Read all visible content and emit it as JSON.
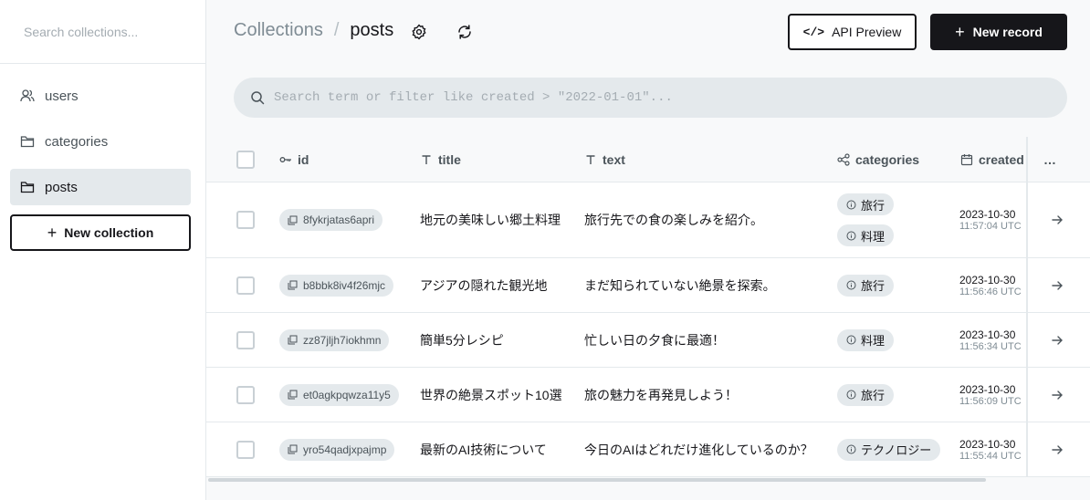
{
  "sidebar": {
    "search_placeholder": "Search collections...",
    "items": [
      {
        "label": "users",
        "icon": "users-icon",
        "active": false
      },
      {
        "label": "categories",
        "icon": "folder-icon",
        "active": false
      },
      {
        "label": "posts",
        "icon": "folder-icon",
        "active": true
      }
    ],
    "new_collection_label": "New collection"
  },
  "header": {
    "breadcrumb_parent": "Collections",
    "breadcrumb_separator": "/",
    "breadcrumb_current": "posts",
    "api_preview_label": "API Preview",
    "new_record_label": "New record"
  },
  "search": {
    "placeholder": "Search term or filter like created > \"2022-01-01\"..."
  },
  "table": {
    "columns": [
      {
        "label": "id",
        "icon": "key-icon"
      },
      {
        "label": "title",
        "icon": "text-type-icon"
      },
      {
        "label": "text",
        "icon": "text-type-icon"
      },
      {
        "label": "categories",
        "icon": "relation-icon"
      },
      {
        "label": "created",
        "icon": "calendar-icon"
      }
    ],
    "more_label": "…",
    "rows": [
      {
        "id": "8fykrjatas6apri",
        "title": "地元の美味しい郷土料理",
        "text": "旅行先での食の楽しみを紹介。",
        "categories": [
          "旅行",
          "料理"
        ],
        "date": "2023-10-30",
        "time": "11:57:04 UTC"
      },
      {
        "id": "b8bbk8iv4f26mjc",
        "title": "アジアの隠れた観光地",
        "text": "まだ知られていない絶景を探索。",
        "categories": [
          "旅行"
        ],
        "date": "2023-10-30",
        "time": "11:56:46 UTC"
      },
      {
        "id": "zz87jljh7iokhmn",
        "title": "簡単5分レシピ",
        "text": "忙しい日の夕食に最適！",
        "categories": [
          "料理"
        ],
        "date": "2023-10-30",
        "time": "11:56:34 UTC"
      },
      {
        "id": "et0agkpqwza11y5",
        "title": "世界の絶景スポット10選",
        "text": "旅の魅力を再発見しよう！",
        "categories": [
          "旅行"
        ],
        "date": "2023-10-30",
        "time": "11:56:09 UTC"
      },
      {
        "id": "yro54qadjxpajmp",
        "title": "最新のAI技術について",
        "text": "今日のAIはどれだけ進化しているのか？",
        "categories": [
          "テクノロジー"
        ],
        "date": "2023-10-30",
        "time": "11:55:44 UTC"
      }
    ]
  }
}
